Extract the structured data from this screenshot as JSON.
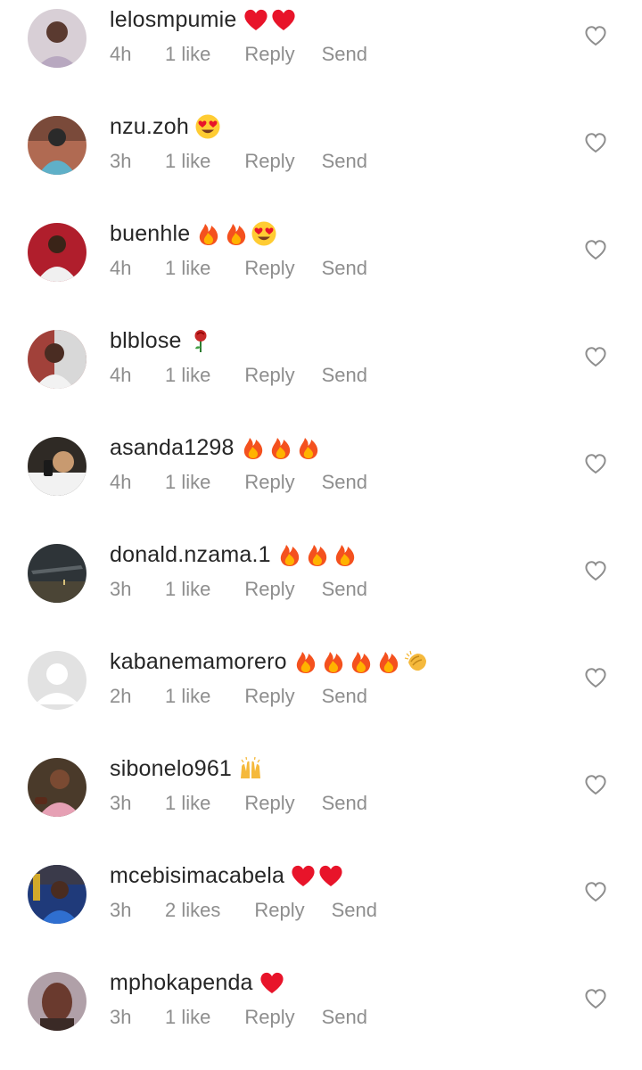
{
  "comments": [
    {
      "username": "lelosmpumie",
      "emojis": [
        "red-heart",
        "red-heart"
      ],
      "time": "4h",
      "likes": "1 like",
      "reply": "Reply",
      "send": "Send",
      "avatar_color": "#d8cfd6"
    },
    {
      "username": "nzu.zoh",
      "emojis": [
        "heart-eyes"
      ],
      "time": "3h",
      "likes": "1 like",
      "reply": "Reply",
      "send": "Send",
      "avatar_color": "#7a4a3a"
    },
    {
      "username": "buenhle",
      "emojis": [
        "fire",
        "fire",
        "heart-eyes"
      ],
      "time": "4h",
      "likes": "1 like",
      "reply": "Reply",
      "send": "Send",
      "avatar_color": "#b01e2c"
    },
    {
      "username": "blblose",
      "emojis": [
        "rose"
      ],
      "time": "4h",
      "likes": "1 like",
      "reply": "Reply",
      "send": "Send",
      "avatar_color": "#9c7a70"
    },
    {
      "username": "asanda1298",
      "emojis": [
        "fire",
        "fire",
        "fire"
      ],
      "time": "4h",
      "likes": "1 like",
      "reply": "Reply",
      "send": "Send",
      "avatar_color": "#2f2a25"
    },
    {
      "username": "donald.nzama.1",
      "emojis": [
        "fire",
        "fire",
        "fire"
      ],
      "time": "3h",
      "likes": "1 like",
      "reply": "Reply",
      "send": "Send",
      "avatar_color": "#3a3a3a"
    },
    {
      "username": "kabanemamorero",
      "emojis": [
        "fire",
        "fire",
        "fire",
        "fire",
        "clapping-hands"
      ],
      "time": "2h",
      "likes": "1 like",
      "reply": "Reply",
      "send": "Send",
      "avatar_color": "#e2e2e2"
    },
    {
      "username": "sibonelo961",
      "emojis": [
        "raising-hands"
      ],
      "time": "3h",
      "likes": "1 like",
      "reply": "Reply",
      "send": "Send",
      "avatar_color": "#8a6048"
    },
    {
      "username": "mcebisimacabela",
      "emojis": [
        "red-heart",
        "red-heart"
      ],
      "time": "3h",
      "likes": "2 likes",
      "reply": "Reply",
      "send": "Send",
      "avatar_color": "#1f3a7a"
    },
    {
      "username": "mphokapenda",
      "emojis": [
        "red-heart"
      ],
      "time": "3h",
      "likes": "1 like",
      "reply": "Reply",
      "send": "Send",
      "avatar_color": "#6a3a2e"
    }
  ]
}
